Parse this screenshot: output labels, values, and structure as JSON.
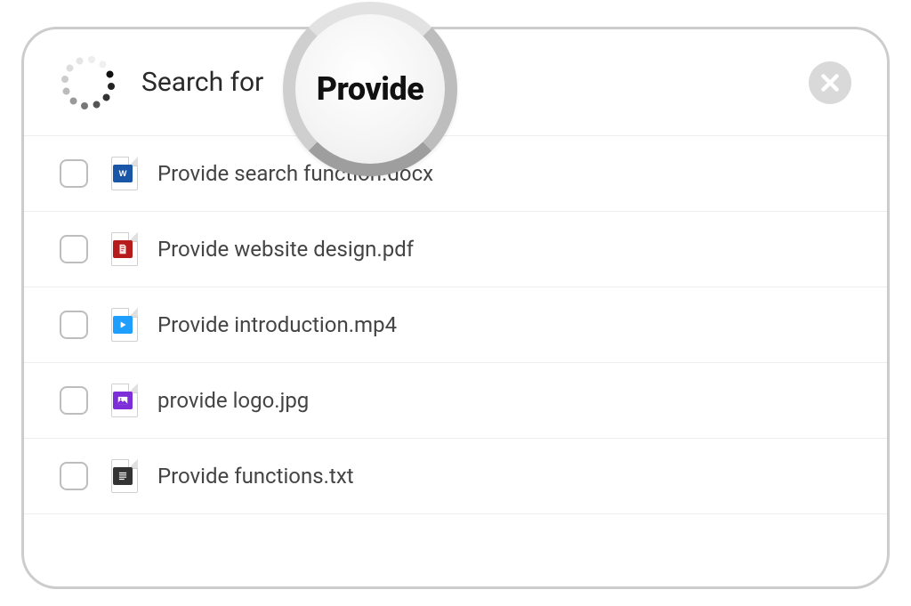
{
  "search": {
    "label": "Search for",
    "query": "Provide"
  },
  "results": [
    {
      "filename": "Provide search function.docx",
      "type": "word"
    },
    {
      "filename": "Provide website design.pdf",
      "type": "pdf"
    },
    {
      "filename": "Provide introduction.mp4",
      "type": "mp4"
    },
    {
      "filename": "provide logo.jpg",
      "type": "img"
    },
    {
      "filename": "Provide functions.txt",
      "type": "txt"
    }
  ]
}
